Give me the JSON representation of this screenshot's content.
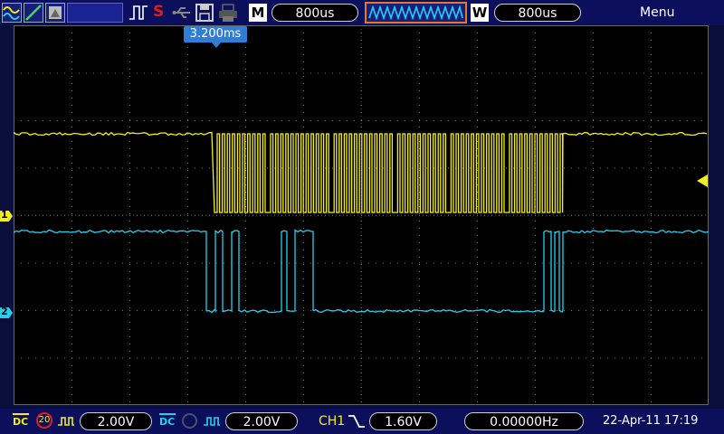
{
  "header": {
    "mode_letter": "M",
    "timebase": "800us",
    "window_letter": "W",
    "window_timebase": "800us",
    "menu_label": "Menu",
    "stop_indicator": "S",
    "trigger_position": "3.200ms"
  },
  "channels": {
    "ch1": {
      "marker": "1",
      "color": "#f4ee1a"
    },
    "ch2": {
      "marker": "2",
      "color": "#27d0ef"
    }
  },
  "footer": {
    "ch1_coupling": "DC",
    "ch1_bw_limit": "20",
    "ch1_volts_div": "2.00V",
    "ch2_coupling": "DC",
    "ch2_volts_div": "2.00V",
    "trigger_source": "CH1",
    "trigger_level": "1.60V",
    "frequency": "0.00000Hz",
    "datetime": "22-Apr-11 17:19"
  },
  "icons": [
    "run-mode-icon",
    "auto-icon",
    "print-icon",
    "trigger-edge-icon",
    "usb-icon",
    "save-icon",
    "printer-icon",
    "waveform-window-icon",
    "trigger-level-marker-icon",
    "coupling-dc-icon",
    "bandwidth-limit-icon",
    "probe-icon",
    "trigger-slope-falling-icon"
  ]
}
